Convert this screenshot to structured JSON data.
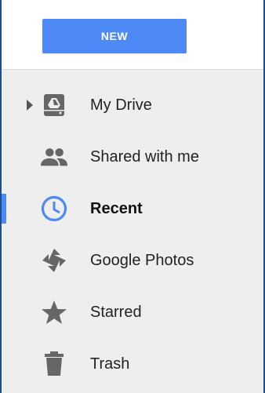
{
  "toolbar": {
    "new_label": "NEW"
  },
  "nav": {
    "items": [
      {
        "label": "My Drive",
        "icon": "drive-icon"
      },
      {
        "label": "Shared with me",
        "icon": "people-icon"
      },
      {
        "label": "Recent",
        "icon": "clock-icon",
        "active": true
      },
      {
        "label": "Google Photos",
        "icon": "pinwheel-icon"
      },
      {
        "label": "Starred",
        "icon": "star-icon"
      },
      {
        "label": "Trash",
        "icon": "trash-icon"
      }
    ]
  },
  "colors": {
    "accent": "#4d8af5",
    "icon_gray": "#666666",
    "sidebar_bg": "#eeeeee"
  }
}
